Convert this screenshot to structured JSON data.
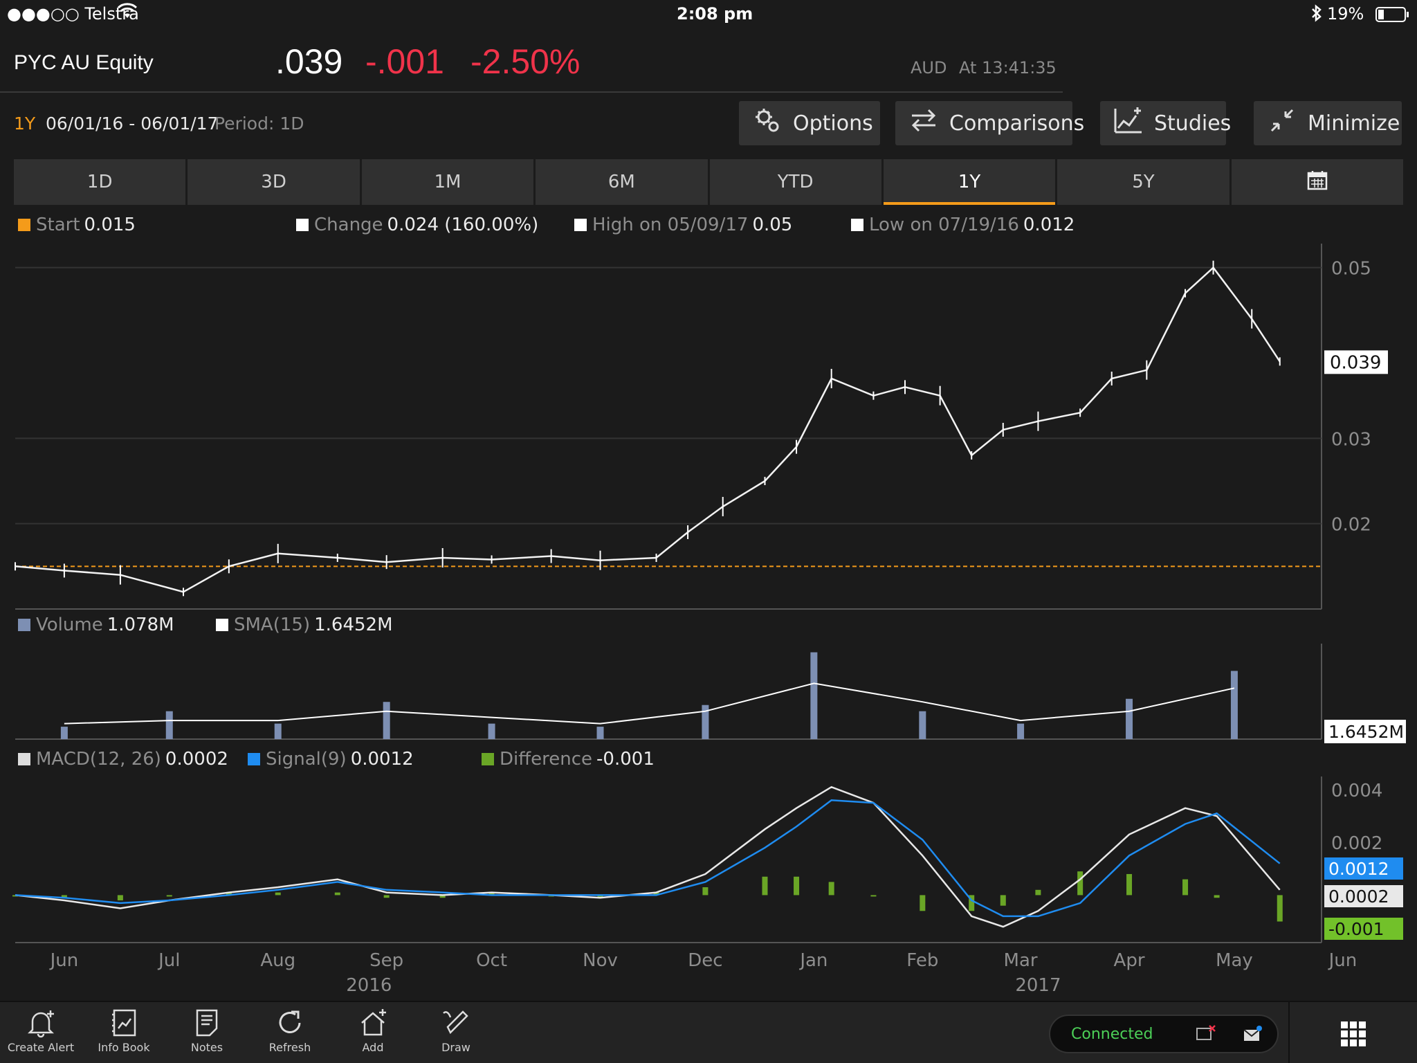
{
  "status_bar": {
    "carrier": "●●●○○ Telstra",
    "time": "2:08 pm",
    "battery": "19%"
  },
  "header": {
    "ticker": "PYC AU Equity",
    "price": ".039",
    "change": "-.001",
    "change_pct": "-2.50%",
    "currency": "AUD",
    "updated": "At 13:41:35"
  },
  "range": {
    "label": "1Y",
    "dates": "06/01/16 - 06/01/17",
    "period": "Period: 1D"
  },
  "buttons": {
    "options": "Options",
    "comparisons": "Comparisons",
    "studies": "Studies",
    "minimize": "Minimize"
  },
  "tabs": [
    {
      "label": "1D"
    },
    {
      "label": "3D"
    },
    {
      "label": "1M"
    },
    {
      "label": "6M"
    },
    {
      "label": "YTD"
    },
    {
      "label": "1Y"
    },
    {
      "label": "5Y"
    }
  ],
  "active_tab": "1Y",
  "price_legend": {
    "start_label": "Start",
    "start_value": "0.015",
    "change_label": "Change",
    "change_value": "0.024 (160.00%)",
    "high_label": "High on 05/09/17",
    "high_value": "0.05",
    "low_label": "Low on 07/19/16",
    "low_value": "0.012"
  },
  "volume_legend": {
    "volume_label": "Volume",
    "volume_value": "1.078M",
    "sma_label": "SMA(15)",
    "sma_value": "1.6452M"
  },
  "macd_legend": {
    "macd_label": "MACD(12, 26)",
    "macd_value": "0.0002",
    "signal_label": "Signal(9)",
    "signal_value": "0.0012",
    "diff_label": "Difference",
    "diff_value": "-0.001"
  },
  "tags": {
    "price": "0.039",
    "sma": "1.6452M",
    "signal": "0.0012",
    "macd": "0.0002",
    "diff": "-0.001"
  },
  "colors": {
    "accent": "#f49b1a",
    "negative": "#f0334a",
    "volume": "#7d8fb3",
    "signal": "#1f8cf0",
    "difference": "#6aa626",
    "connected": "#4ccf57"
  },
  "chart_data": [
    {
      "type": "line",
      "name": "price",
      "ylim": [
        0.01,
        0.052
      ],
      "yticks": [
        0.02,
        0.03,
        0.05
      ],
      "ytick_labels": [
        "0.02",
        "0.03",
        "0.05"
      ],
      "start_reference": 0.015,
      "x": [
        "2016-06-01",
        "2016-06-15",
        "2016-07-01",
        "2016-07-19",
        "2016-08-01",
        "2016-08-15",
        "2016-09-01",
        "2016-09-15",
        "2016-10-01",
        "2016-10-15",
        "2016-11-01",
        "2016-11-15",
        "2016-12-01",
        "2016-12-10",
        "2016-12-20",
        "2017-01-01",
        "2017-01-10",
        "2017-01-20",
        "2017-02-01",
        "2017-02-10",
        "2017-02-20",
        "2017-03-01",
        "2017-03-10",
        "2017-03-20",
        "2017-04-01",
        "2017-04-10",
        "2017-04-20",
        "2017-05-01",
        "2017-05-09",
        "2017-05-20",
        "2017-05-28"
      ],
      "values": [
        0.015,
        0.0145,
        0.014,
        0.012,
        0.015,
        0.0165,
        0.016,
        0.0155,
        0.016,
        0.0158,
        0.0162,
        0.0157,
        0.016,
        0.019,
        0.022,
        0.025,
        0.029,
        0.037,
        0.035,
        0.036,
        0.035,
        0.028,
        0.031,
        0.032,
        0.033,
        0.037,
        0.038,
        0.047,
        0.05,
        0.044,
        0.039
      ]
    },
    {
      "type": "bar",
      "name": "Volume",
      "x": [
        "2016-06",
        "2016-07",
        "2016-08",
        "2016-09",
        "2016-10",
        "2016-11",
        "2016-12",
        "2017-01",
        "2017-02",
        "2017-03",
        "2017-04",
        "2017-05"
      ],
      "values": [
        0.4,
        0.9,
        0.5,
        1.2,
        0.5,
        0.4,
        1.1,
        2.8,
        0.9,
        0.5,
        1.3,
        2.2
      ],
      "sma_values": [
        0.5,
        0.6,
        0.6,
        0.9,
        0.7,
        0.5,
        0.9,
        1.8,
        1.2,
        0.6,
        0.9,
        1.6452
      ]
    },
    {
      "type": "line",
      "name": "MACD",
      "ylim": [
        -0.0018,
        0.0045
      ],
      "yticks": [
        0.002,
        0.004
      ],
      "ytick_labels": [
        "0.002",
        "0.004"
      ],
      "x": [
        "2016-06-01",
        "2016-06-15",
        "2016-07-01",
        "2016-07-15",
        "2016-08-01",
        "2016-08-15",
        "2016-09-01",
        "2016-09-15",
        "2016-10-01",
        "2016-10-15",
        "2016-11-01",
        "2016-11-15",
        "2016-12-01",
        "2016-12-15",
        "2017-01-01",
        "2017-01-10",
        "2017-01-20",
        "2017-02-01",
        "2017-02-15",
        "2017-03-01",
        "2017-03-10",
        "2017-03-20",
        "2017-04-01",
        "2017-04-15",
        "2017-05-01",
        "2017-05-10",
        "2017-05-28"
      ],
      "series": [
        {
          "name": "MACD(12, 26)",
          "values": [
            0,
            -0.0002,
            -0.0005,
            -0.0002,
            0.0001,
            0.0003,
            0.0006,
            0.0001,
            0,
            0.0001,
            0,
            -0.0001,
            0.0001,
            0.0008,
            0.0025,
            0.0033,
            0.0041,
            0.0035,
            0.0015,
            -0.0008,
            -0.0012,
            -0.0006,
            0.0006,
            0.0023,
            0.0033,
            0.003,
            0.0002
          ]
        },
        {
          "name": "Signal(9)",
          "values": [
            0,
            -0.0001,
            -0.0003,
            -0.0002,
            0,
            0.0002,
            0.0005,
            0.0002,
            0.0001,
            0,
            0,
            0,
            0,
            0.0005,
            0.0018,
            0.0026,
            0.0036,
            0.0035,
            0.0021,
            -0.0002,
            -0.0008,
            -0.0008,
            -0.0003,
            0.0015,
            0.0027,
            0.0031,
            0.0012
          ]
        },
        {
          "name": "Difference",
          "values": [
            0,
            -0.0001,
            -0.0002,
            0,
            0.0001,
            0.0001,
            0.0001,
            -0.0001,
            -0.0001,
            0.0001,
            0,
            -0.0001,
            0.0001,
            0.0003,
            0.0007,
            0.0007,
            0.0005,
            0,
            -0.0006,
            -0.0006,
            -0.0004,
            0.0002,
            0.0009,
            0.0008,
            0.0006,
            -0.0001,
            -0.001
          ]
        }
      ]
    }
  ],
  "x_axis": {
    "months": [
      "Jun",
      "Jul",
      "Aug",
      "Sep",
      "Oct",
      "Nov",
      "Dec",
      "Jan",
      "Feb",
      "Mar",
      "Apr",
      "May",
      "Jun"
    ],
    "years": [
      "2016",
      "2017"
    ]
  },
  "toolbar": {
    "create_alert": "Create Alert",
    "info_book": "Info Book",
    "notes": "Notes",
    "refresh": "Refresh",
    "add": "Add",
    "draw": "Draw",
    "connection": "Connected"
  }
}
